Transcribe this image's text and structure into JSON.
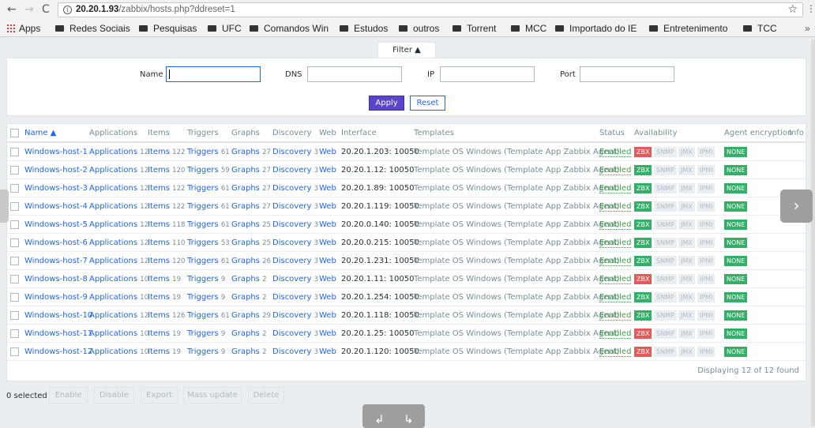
{
  "browser": {
    "url_host": "20.20.1.93",
    "url_path": "/zabbix/hosts.php?ddreset=1",
    "bookmarks": [
      "Apps",
      "Redes Sociais",
      "Pesquisas",
      "UFC",
      "Comandos Win",
      "Estudos",
      "outros",
      "Torrent",
      "MCC",
      "Importado do IE",
      "Entretenimento",
      "TCC"
    ],
    "more": "»"
  },
  "filter": {
    "tab_label": "Filter ▲",
    "name_label": "Name",
    "dns_label": "DNS",
    "ip_label": "IP",
    "port_label": "Port",
    "apply_label": "Apply",
    "reset_label": "Reset"
  },
  "table": {
    "headers": {
      "name": "Name ▲",
      "applications": "Applications",
      "items": "Items",
      "triggers": "Triggers",
      "graphs": "Graphs",
      "discovery": "Discovery",
      "web": "Web",
      "interface": "Interface",
      "templates": "Templates",
      "status": "Status",
      "availability": "Availability",
      "agent_encryption": "Agent encryption",
      "info": "Info"
    },
    "labels": {
      "applications": "Applications",
      "items": "Items",
      "triggers": "Triggers",
      "graphs": "Graphs",
      "discovery": "Discovery",
      "web": "Web",
      "template": "Template OS Windows",
      "template_open": " (",
      "template_child": "Template App Zabbix Agent",
      "template_close": ")",
      "zbx": "ZBX",
      "snmp": "SNMP",
      "jmx": "JMX",
      "ipmi": "IPMI",
      "none": "NONE"
    },
    "rows": [
      {
        "name": "Windows-host-1",
        "applications": "12",
        "items": "122",
        "triggers": "61",
        "graphs": "27",
        "discovery": "3",
        "interface": "20.20.1.203: 10050",
        "status": "Enabled",
        "zbx": "red"
      },
      {
        "name": "Windows-host-2",
        "applications": "12",
        "items": "120",
        "triggers": "59",
        "graphs": "27",
        "discovery": "3",
        "interface": "20.20.1.12: 10050",
        "status": "Enabled",
        "zbx": "green"
      },
      {
        "name": "Windows-host-3",
        "applications": "12",
        "items": "122",
        "triggers": "61",
        "graphs": "27",
        "discovery": "3",
        "interface": "20.20.1.89: 10050",
        "status": "Enabled",
        "zbx": "green"
      },
      {
        "name": "Windows-host-4",
        "applications": "12",
        "items": "122",
        "triggers": "61",
        "graphs": "27",
        "discovery": "3",
        "interface": "20.20.1.119: 10050",
        "status": "Enabled",
        "zbx": "green"
      },
      {
        "name": "Windows-host-5",
        "applications": "12",
        "items": "118",
        "triggers": "61",
        "graphs": "25",
        "discovery": "3",
        "interface": "20.20.0.140: 10050",
        "status": "Enabled",
        "zbx": "green"
      },
      {
        "name": "Windows-host-6",
        "applications": "12",
        "items": "110",
        "triggers": "53",
        "graphs": "25",
        "discovery": "3",
        "interface": "20.20.0.215: 10050",
        "status": "Enabled",
        "zbx": "green"
      },
      {
        "name": "Windows-host-7",
        "applications": "12",
        "items": "120",
        "triggers": "61",
        "graphs": "26",
        "discovery": "3",
        "interface": "20.20.1.231: 10050",
        "status": "Enabled",
        "zbx": "green"
      },
      {
        "name": "Windows-host-8",
        "applications": "10",
        "items": "19",
        "triggers": "9",
        "graphs": "2",
        "discovery": "3",
        "interface": "20.20.1.11: 10050",
        "status": "Enabled",
        "zbx": "red"
      },
      {
        "name": "Windows-host-9",
        "applications": "10",
        "items": "19",
        "triggers": "9",
        "graphs": "2",
        "discovery": "3",
        "interface": "20.20.1.254: 10050",
        "status": "Enabled",
        "zbx": "green"
      },
      {
        "name": "Windows-host-10",
        "applications": "12",
        "items": "126",
        "triggers": "61",
        "graphs": "29",
        "discovery": "3",
        "interface": "20.20.1.118: 10050",
        "status": "Enabled",
        "zbx": "green"
      },
      {
        "name": "Windows-host-11",
        "applications": "10",
        "items": "19",
        "triggers": "9",
        "graphs": "2",
        "discovery": "3",
        "interface": "20.20.1.25: 10050",
        "status": "Enabled",
        "zbx": "red"
      },
      {
        "name": "Windows-host-12",
        "applications": "10",
        "items": "19",
        "triggers": "9",
        "graphs": "2",
        "discovery": "3",
        "interface": "20.20.1.120: 10050",
        "status": "Enabled",
        "zbx": "red"
      }
    ],
    "footer": "Displaying 12 of 12 found"
  },
  "actions": {
    "selected": "0 selected",
    "enable": "Enable",
    "disable": "Disable",
    "export": "Export",
    "mass_update": "Mass update",
    "delete": "Delete"
  },
  "colors": {
    "link": "#1f65f4",
    "enabled": "#429e47",
    "zbx_red": "#e45959",
    "zbx_green": "#34af67",
    "apply": "#5a44cc"
  }
}
